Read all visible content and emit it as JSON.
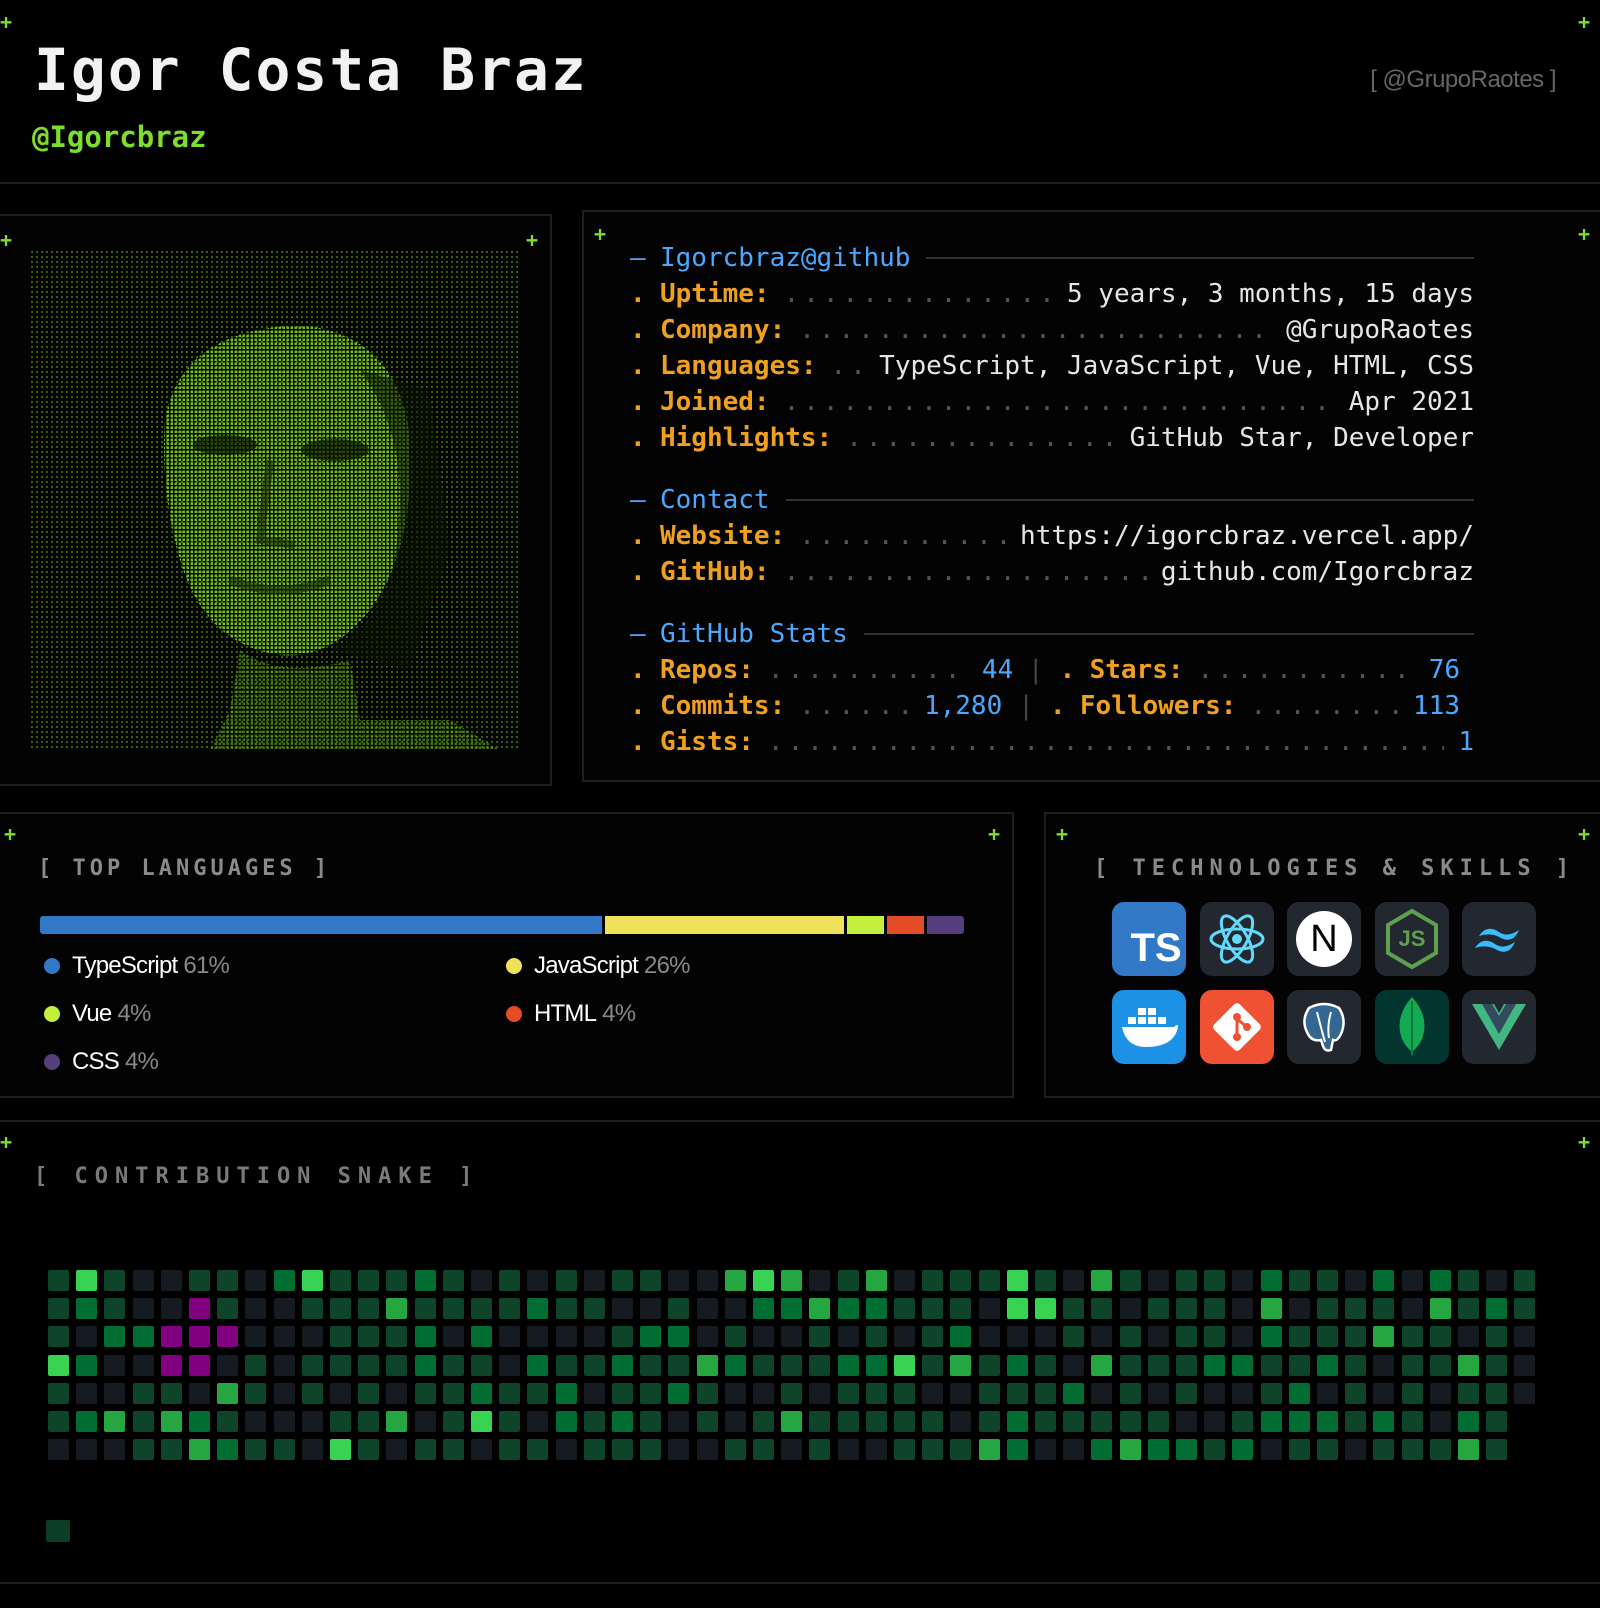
{
  "header": {
    "name": "Igor Costa Braz",
    "handle": "@Igorcbraz",
    "org_tag": "[ @GrupoRaotes ]"
  },
  "portrait": {
    "alt": "ASCII portrait",
    "color": "#6fbf1a"
  },
  "info": {
    "title": "Igorcbraz@github",
    "uptime_key": "Uptime:",
    "uptime": "5 years, 3 months, 15 days",
    "company_key": "Company:",
    "company": "@GrupoRaotes",
    "languages_key": "Languages:",
    "languages": "TypeScript, JavaScript, Vue, HTML, CSS",
    "joined_key": "Joined:",
    "joined": "Apr 2021",
    "highlights_key": "Highlights:",
    "highlights": "GitHub Star, Developer",
    "contact_title": "Contact",
    "website_key": "Website:",
    "website": "https://igorcbraz.vercel.app/",
    "github_key": "GitHub:",
    "github": "github.com/Igorcbraz",
    "stats_title": "GitHub Stats",
    "repos_key": "Repos:",
    "repos": "44",
    "stars_key": "Stars:",
    "stars": "76",
    "commits_key": "Commits:",
    "commits": "1,280",
    "followers_key": "Followers:",
    "followers": "113",
    "gists_key": "Gists:",
    "gists": "1",
    "bullet": ".",
    "dash": "—",
    "sep": "|"
  },
  "top_languages": {
    "title": "[ TOP LANGUAGES ]",
    "items": [
      {
        "name": "TypeScript",
        "pct": "61%",
        "value": 61,
        "color": "#3178c6"
      },
      {
        "name": "JavaScript",
        "pct": "26%",
        "value": 26,
        "color": "#f1e05a"
      },
      {
        "name": "Vue",
        "pct": "4%",
        "value": 4,
        "color": "#c3f03c"
      },
      {
        "name": "HTML",
        "pct": "4%",
        "value": 4,
        "color": "#e34c26"
      },
      {
        "name": "CSS",
        "pct": "4%",
        "value": 4,
        "color": "#563d7c"
      }
    ]
  },
  "technologies": {
    "title": "[ TECHNOLOGIES & SKILLS ]",
    "icons": [
      "typescript-icon",
      "react-icon",
      "nextjs-icon",
      "nodejs-icon",
      "tailwind-icon",
      "docker-icon",
      "git-icon",
      "postgresql-icon",
      "mongodb-icon",
      "vue-icon"
    ],
    "ts_label": "TS",
    "js_label": "JS",
    "next_label": "N"
  },
  "contribution": {
    "title": "[ CONTRIBUTION SNAKE ]",
    "colors": {
      "empty": "#161b22",
      "l1": "#0e4429",
      "l2": "#006d32",
      "l3": "#26a641",
      "l4": "#39d353",
      "snake": "#800080"
    }
  }
}
